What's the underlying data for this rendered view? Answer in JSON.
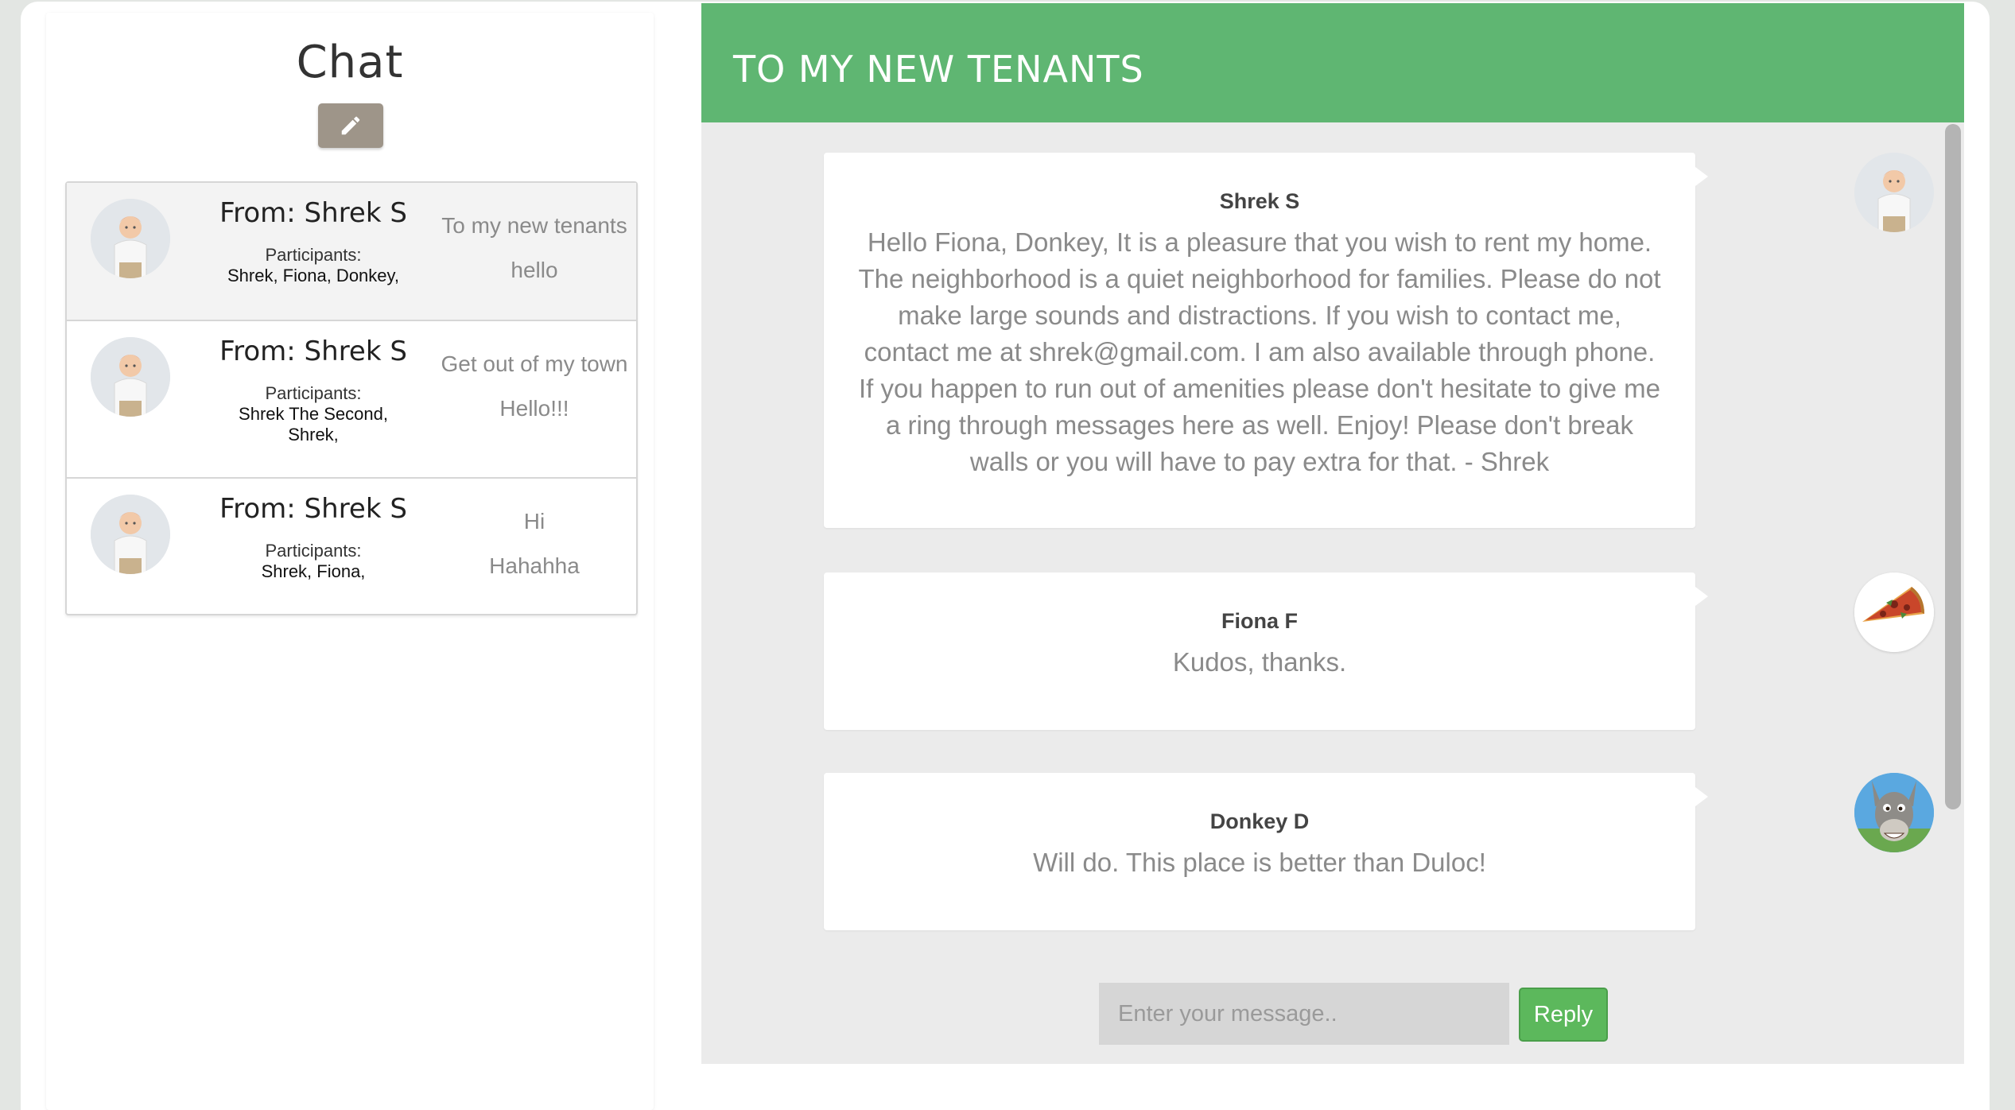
{
  "sidebar": {
    "title": "Chat",
    "edit_icon": "pencil-icon",
    "threads": [
      {
        "from": "From: Shrek S",
        "participants_label": "Participants:",
        "participants": "Shrek, Fiona, Donkey,",
        "subject": "To my new tenants",
        "preview": "hello",
        "avatar": "shrek-avatar"
      },
      {
        "from": "From: Shrek S",
        "participants_label": "Participants:",
        "participants": "Shrek The Second, Shrek,",
        "subject": "Get out of my town",
        "preview": "Hello!!!",
        "avatar": "shrek-avatar"
      },
      {
        "from": "From: Shrek S",
        "participants_label": "Participants:",
        "participants": "Shrek, Fiona,",
        "subject": "Hi",
        "preview": "Hahahha",
        "avatar": "shrek-avatar"
      }
    ]
  },
  "conversation": {
    "title": "TO MY NEW TENANTS",
    "header_color": "#5fb672",
    "messages": [
      {
        "author": "Shrek S",
        "text": "Hello Fiona, Donkey, It is a pleasure that you wish to rent my home. The neighborhood is a quiet neighborhood for families. Please do not make large sounds and distractions. If you wish to contact me, contact me at shrek@gmail.com. I am also available through phone. If you happen to run out of amenities please don't hesitate to give me a ring through messages here as well. Enjoy! Please don't break walls or you will have to pay extra for that. - Shrek",
        "avatar": "shrek-avatar"
      },
      {
        "author": "Fiona F",
        "text": "Kudos, thanks.",
        "avatar": "pizza-avatar"
      },
      {
        "author": "Donkey D",
        "text": "Will do. This place is better than Duloc!",
        "avatar": "donkey-avatar"
      }
    ],
    "reply": {
      "placeholder": "Enter your message..",
      "value": "",
      "button_label": "Reply",
      "button_color": "#5cb85c"
    }
  }
}
